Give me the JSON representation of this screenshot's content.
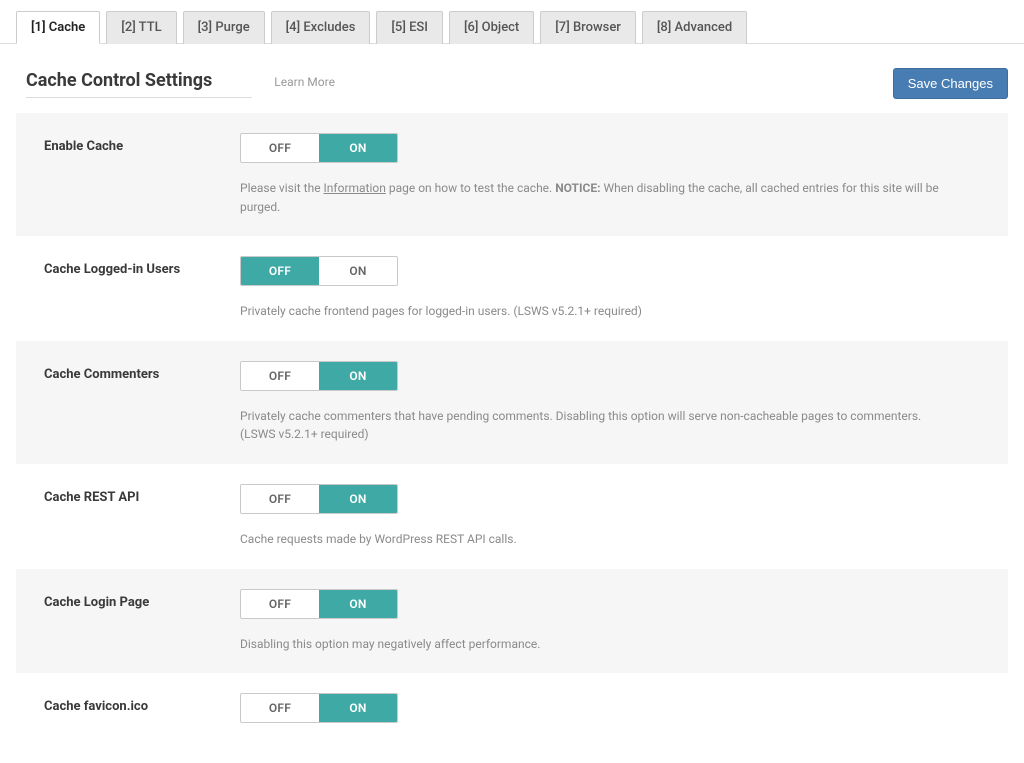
{
  "tabs": [
    {
      "label": "[1] Cache",
      "active": true
    },
    {
      "label": "[2] TTL",
      "active": false
    },
    {
      "label": "[3] Purge",
      "active": false
    },
    {
      "label": "[4] Excludes",
      "active": false
    },
    {
      "label": "[5] ESI",
      "active": false
    },
    {
      "label": "[6] Object",
      "active": false
    },
    {
      "label": "[7] Browser",
      "active": false
    },
    {
      "label": "[8] Advanced",
      "active": false
    }
  ],
  "header": {
    "title": "Cache Control Settings",
    "learn_more": "Learn More",
    "save_button": "Save Changes"
  },
  "toggle_labels": {
    "off": "OFF",
    "on": "ON"
  },
  "settings": [
    {
      "key": "enable-cache",
      "label": "Enable Cache",
      "value": "on",
      "desc_prefix": "Please visit the ",
      "desc_link": "Information",
      "desc_mid": " page on how to test the cache. ",
      "notice_label": "NOTICE:",
      "desc_after_notice": " When disabling the cache, all cached entries for this site will be purged."
    },
    {
      "key": "cache-logged-in",
      "label": "Cache Logged-in Users",
      "value": "off",
      "desc": "Privately cache frontend pages for logged-in users. (LSWS v5.2.1+ required)"
    },
    {
      "key": "cache-commenters",
      "label": "Cache Commenters",
      "value": "on",
      "desc": "Privately cache commenters that have pending comments. Disabling this option will serve non-cacheable pages to commenters. (LSWS v5.2.1+ required)"
    },
    {
      "key": "cache-rest-api",
      "label": "Cache REST API",
      "value": "on",
      "desc": "Cache requests made by WordPress REST API calls."
    },
    {
      "key": "cache-login-page",
      "label": "Cache Login Page",
      "value": "on",
      "desc": "Disabling this option may negatively affect performance."
    },
    {
      "key": "cache-favicon",
      "label": "Cache favicon.ico",
      "value": "on",
      "desc": ""
    }
  ]
}
